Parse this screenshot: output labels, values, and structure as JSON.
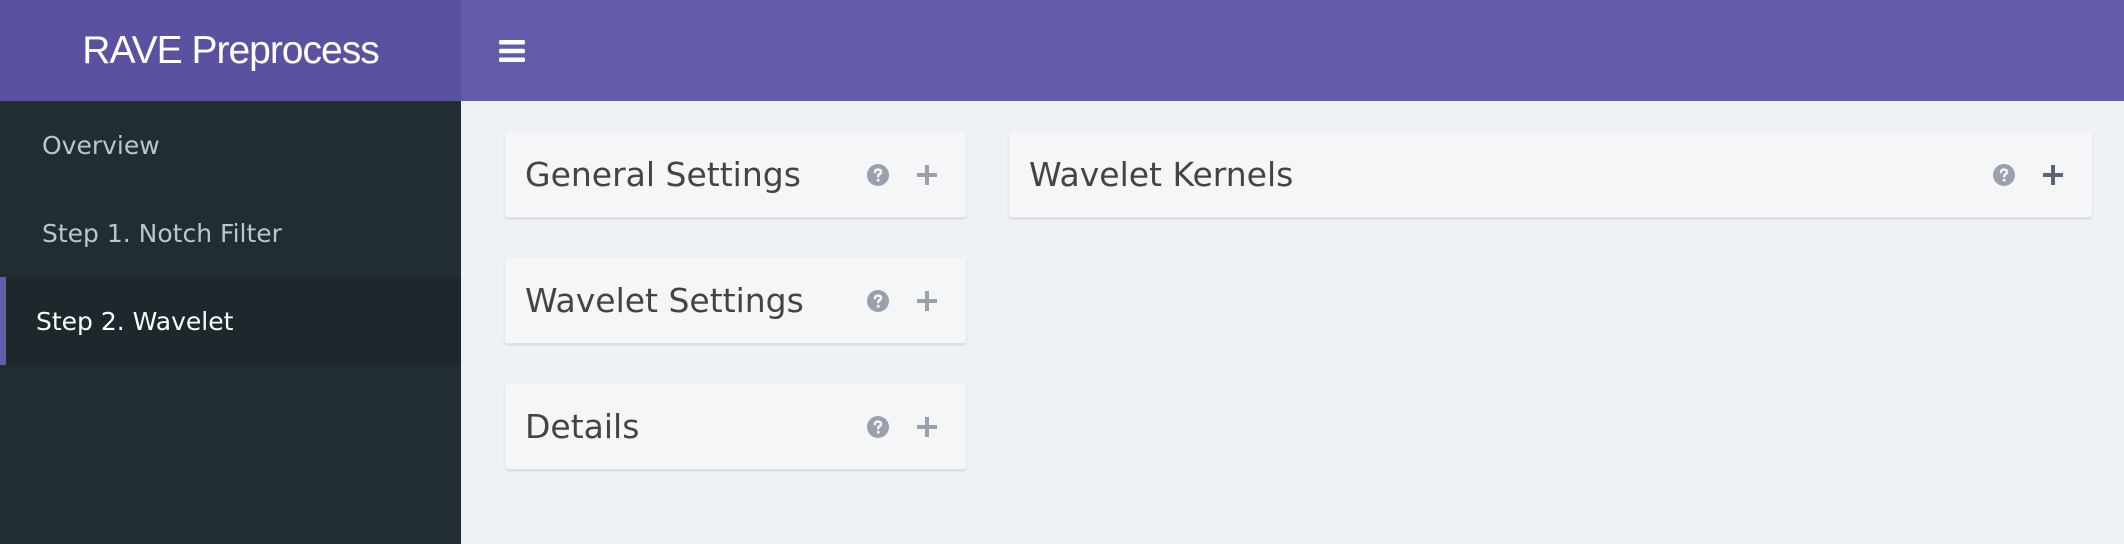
{
  "app": {
    "title": "RAVE Preprocess"
  },
  "header": {
    "menu_icon": "hamburger-menu-icon"
  },
  "sidebar": {
    "items": [
      {
        "label": "Overview",
        "active": false
      },
      {
        "label": "Step 1. Notch Filter",
        "active": false
      },
      {
        "label": "Step 2. Wavelet",
        "active": true
      }
    ]
  },
  "main": {
    "boxes": [
      {
        "title": "General Settings",
        "help_icon": "question-circle-icon",
        "expand_icon": "plus-icon"
      },
      {
        "title": "Wavelet Settings",
        "help_icon": "question-circle-icon",
        "expand_icon": "plus-icon"
      },
      {
        "title": "Details",
        "help_icon": "question-circle-icon",
        "expand_icon": "plus-icon"
      },
      {
        "title": "Wavelet Kernels",
        "help_icon": "question-circle-icon",
        "expand_icon": "plus-icon"
      }
    ]
  },
  "colors": {
    "accent": "#625caa",
    "logo_bg": "#5a52a0",
    "sidebar_bg": "#222d32",
    "content_bg": "#eef1f5"
  }
}
